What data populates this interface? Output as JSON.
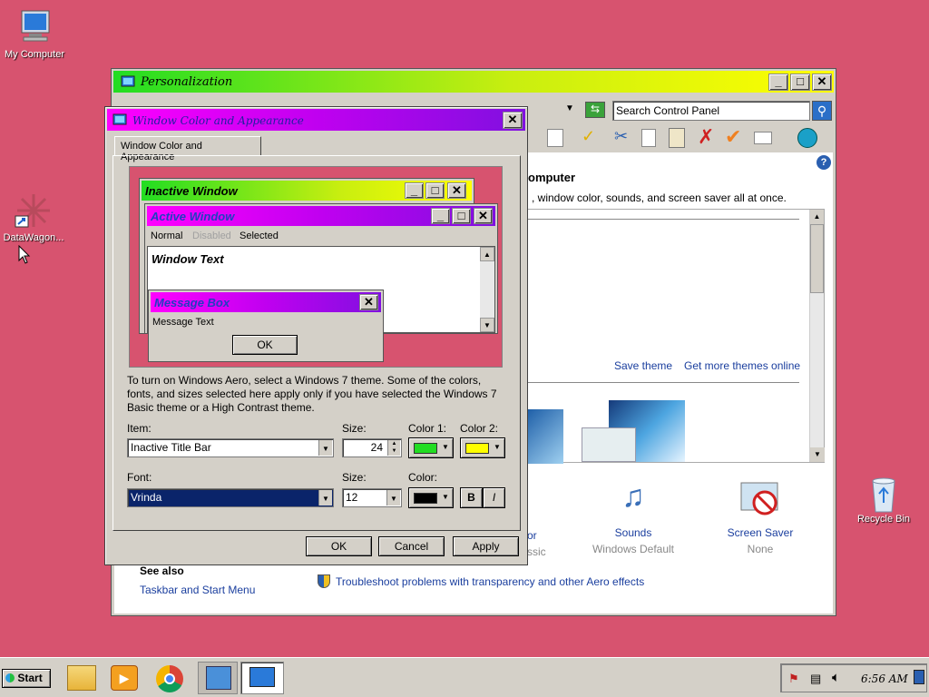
{
  "desktop": {
    "my_computer": "My Computer",
    "datawagon": "DataWagon...",
    "recycle_bin": "Recycle Bin"
  },
  "personalization": {
    "title": "Personalization",
    "search_placeholder": "Search Control Panel",
    "heading_fragment": "omputer",
    "subtitle_fragment": ", window color, sounds, and screen saver all at once.",
    "save_theme": "Save theme",
    "get_more_themes": "Get more themes online",
    "sounds_label": "Sounds",
    "sounds_value": "Windows Default",
    "screensaver_label": "Screen Saver",
    "screensaver_value": "None",
    "color_fragment": "or",
    "color_value_fragment": "ssic",
    "see_also": "See also",
    "taskbar_link": "Taskbar and Start Menu",
    "troubleshoot_link": "Troubleshoot problems with transparency and other Aero effects"
  },
  "dialog": {
    "title": "Window Color and Appearance",
    "tab": "Window Color and Appearance",
    "preview": {
      "inactive": "Inactive Window",
      "active": "Active Window",
      "menu_normal": "Normal",
      "menu_disabled": "Disabled",
      "menu_selected": "Selected",
      "window_text": "Window Text",
      "msgbox_title": "Message Box",
      "msgbox_text": "Message Text",
      "ok": "OK"
    },
    "description": "To turn on Windows Aero, select a Windows 7 theme.  Some of the colors, fonts, and sizes selected here apply only if you have selected the Windows 7 Basic theme or a High Contrast theme.",
    "item_label": "Item:",
    "item_value": "Inactive Title Bar",
    "size_label": "Size:",
    "size_value": "24",
    "color1_label": "Color 1:",
    "color2_label": "Color 2:",
    "font_label": "Font:",
    "font_value": "Vrinda",
    "font_size_label": "Size:",
    "font_size_value": "12",
    "font_color_label": "Color:",
    "bold": "B",
    "italic": "I",
    "ok": "OK",
    "cancel": "Cancel",
    "apply": "Apply",
    "colors": {
      "color1": "#22dd22",
      "color2": "#ffff00",
      "font_color": "#000000"
    }
  },
  "taskbar": {
    "start": "Start",
    "clock": "6:56 AM"
  }
}
